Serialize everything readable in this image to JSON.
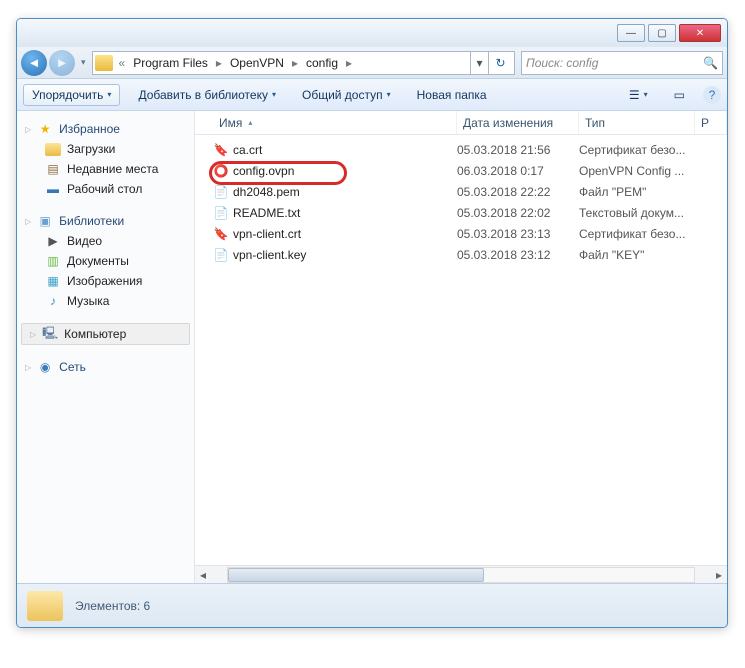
{
  "titlebar": {
    "min": "—",
    "max": "▢",
    "close": "✕"
  },
  "nav": {
    "back": "◄",
    "fwd": "►",
    "crumbs": [
      "Program Files",
      "OpenVPN",
      "config"
    ],
    "sep": "▸",
    "chev": "«",
    "dd": "▾",
    "refresh": "↻",
    "search_placeholder": "Поиск: config",
    "search_icon": "🔍"
  },
  "toolbar": {
    "organize": "Упорядочить",
    "addlib": "Добавить в библиотеку",
    "share": "Общий доступ",
    "newfolder": "Новая папка",
    "tri": "▾",
    "view": "☰",
    "pane": "▭",
    "help": "?"
  },
  "sidebar": {
    "fav": {
      "label": "Избранное",
      "items": [
        "Загрузки",
        "Недавние места",
        "Рабочий стол"
      ]
    },
    "lib": {
      "label": "Библиотеки",
      "items": [
        "Видео",
        "Документы",
        "Изображения",
        "Музыка"
      ]
    },
    "comp": "Компьютер",
    "net": "Сеть"
  },
  "columns": {
    "name": "Имя",
    "date": "Дата изменения",
    "type": "Тип",
    "size": "Р",
    "sort": "▴"
  },
  "files": [
    {
      "icon": "crt",
      "name": "ca.crt",
      "date": "05.03.2018 21:56",
      "type": "Сертификат безо..."
    },
    {
      "icon": "ovpn",
      "name": "config.ovpn",
      "date": "06.03.2018 0:17",
      "type": "OpenVPN Config ..."
    },
    {
      "icon": "txt",
      "name": "dh2048.pem",
      "date": "05.03.2018 22:22",
      "type": "Файл \"PEM\""
    },
    {
      "icon": "txt",
      "name": "README.txt",
      "date": "05.03.2018 22:02",
      "type": "Текстовый докум..."
    },
    {
      "icon": "crt",
      "name": "vpn-client.crt",
      "date": "05.03.2018 23:13",
      "type": "Сертификат безо..."
    },
    {
      "icon": "txt",
      "name": "vpn-client.key",
      "date": "05.03.2018 23:12",
      "type": "Файл \"KEY\""
    }
  ],
  "status": {
    "label": "Элементов: 6"
  }
}
